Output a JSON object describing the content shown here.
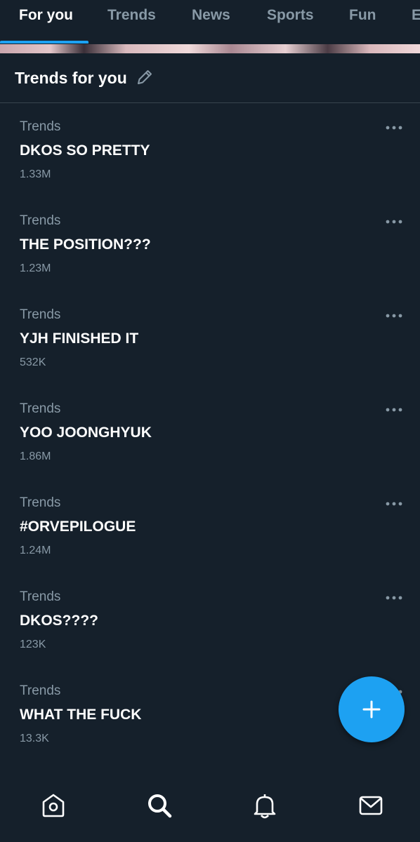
{
  "tabs": [
    {
      "label": "For you",
      "active": true
    },
    {
      "label": "Trends",
      "active": false
    },
    {
      "label": "News",
      "active": false
    },
    {
      "label": "Sports",
      "active": false
    },
    {
      "label": "Fun",
      "active": false
    },
    {
      "label": "E",
      "active": false
    }
  ],
  "section": {
    "title": "Trends for you",
    "edit_icon": "pencil-icon"
  },
  "trends": [
    {
      "category": "Trends",
      "title": "DKOS SO PRETTY",
      "count": "1.33M"
    },
    {
      "category": "Trends",
      "title": "THE POSITION???",
      "count": "1.23M"
    },
    {
      "category": "Trends",
      "title": "YJH FINISHED IT",
      "count": "532K"
    },
    {
      "category": "Trends",
      "title": "YOO JOONGHYUK",
      "count": "1.86M"
    },
    {
      "category": "Trends",
      "title": "#ORVEPILOGUE",
      "count": "1.24M"
    },
    {
      "category": "Trends",
      "title": "DKOS????",
      "count": "123K"
    },
    {
      "category": "Trends",
      "title": "WHAT THE FUCK",
      "count": "13.3K"
    }
  ],
  "fab": {
    "icon": "plus-icon"
  },
  "bottom_nav": [
    {
      "name": "home",
      "icon": "home-icon"
    },
    {
      "name": "search",
      "icon": "search-icon",
      "active": true
    },
    {
      "name": "notifications",
      "icon": "bell-icon"
    },
    {
      "name": "messages",
      "icon": "mail-icon"
    }
  ],
  "colors": {
    "background": "#15202b",
    "accent": "#1da1f2",
    "secondary_text": "#8899a6",
    "divider": "#38444d"
  }
}
